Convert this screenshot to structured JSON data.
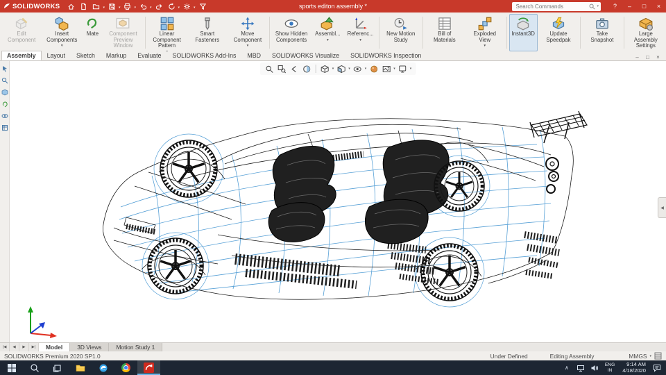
{
  "colors": {
    "titlebar_red": "#c8392a",
    "ribbon_bg": "#f1efec",
    "instant3d_highlight": "#d9e6f2",
    "wireframe_blue": "#4e9bd4",
    "wireframe_black": "#1c1c1c",
    "taskbar_dark": "#1d2633",
    "triad_x_red": "#e03020",
    "triad_y_green": "#18a018",
    "triad_z_blue": "#2040d0"
  },
  "glyphs": {
    "dropdown": "▾",
    "minimize": "–",
    "maximize": "□",
    "close": "×",
    "help": "?",
    "chevron_up": "∧",
    "tab_first": "|◀",
    "tab_prev": "◀",
    "tab_next": "▶",
    "tab_last": "▶|",
    "collapse_panel": "◀"
  },
  "title_bar": {
    "app_name": "SOLIDWORKS",
    "doc_title": "sports editon assembly *",
    "search_placeholder": "Search Commands"
  },
  "ribbon": {
    "buttons": [
      {
        "label": "Edit Component",
        "disabled": true
      },
      {
        "label": "Insert Components",
        "arrow": true
      },
      {
        "label": "Mate"
      },
      {
        "label": "Component Preview Window",
        "disabled": true
      },
      {
        "label": "Linear Component Pattern",
        "arrow": true
      },
      {
        "label": "Smart Fasteners"
      },
      {
        "label": "Move Component",
        "arrow": true
      },
      {
        "label": "Show Hidden Components"
      },
      {
        "label": "Assembl...",
        "arrow": true
      },
      {
        "label": "Referenc...",
        "arrow": true
      },
      {
        "label": "New Motion Study"
      },
      {
        "label": "Bill of Materials"
      },
      {
        "label": "Exploded View",
        "arrow": true
      },
      {
        "label": "Instant3D",
        "active": true
      },
      {
        "label": "Update Speedpak"
      },
      {
        "label": "Take Snapshot"
      },
      {
        "label": "Large Assembly Settings"
      }
    ]
  },
  "ribbon_tabs": {
    "items": [
      {
        "label": "Assembly",
        "active": true
      },
      {
        "label": "Layout"
      },
      {
        "label": "Sketch"
      },
      {
        "label": "Markup"
      },
      {
        "label": "Evaluate"
      },
      {
        "label": "SOLIDWORKS Add-Ins"
      },
      {
        "label": "MBD"
      },
      {
        "label": "SOLIDWORKS Visualize"
      },
      {
        "label": "SOLIDWORKS Inspection"
      }
    ]
  },
  "doc_tabs": {
    "items": [
      {
        "label": "Model",
        "active": true
      },
      {
        "label": "3D Views"
      },
      {
        "label": "Motion Study 1"
      }
    ]
  },
  "status_bar": {
    "left": "SOLIDWORKS Premium 2020 SP1.0",
    "state": "Under Defined",
    "mode": "Editing Assembly",
    "units": "MMGS"
  },
  "taskbar": {
    "language_line1": "ENG",
    "language_line2": "IN",
    "time": "9:14 AM",
    "date": "4/18/2020"
  }
}
